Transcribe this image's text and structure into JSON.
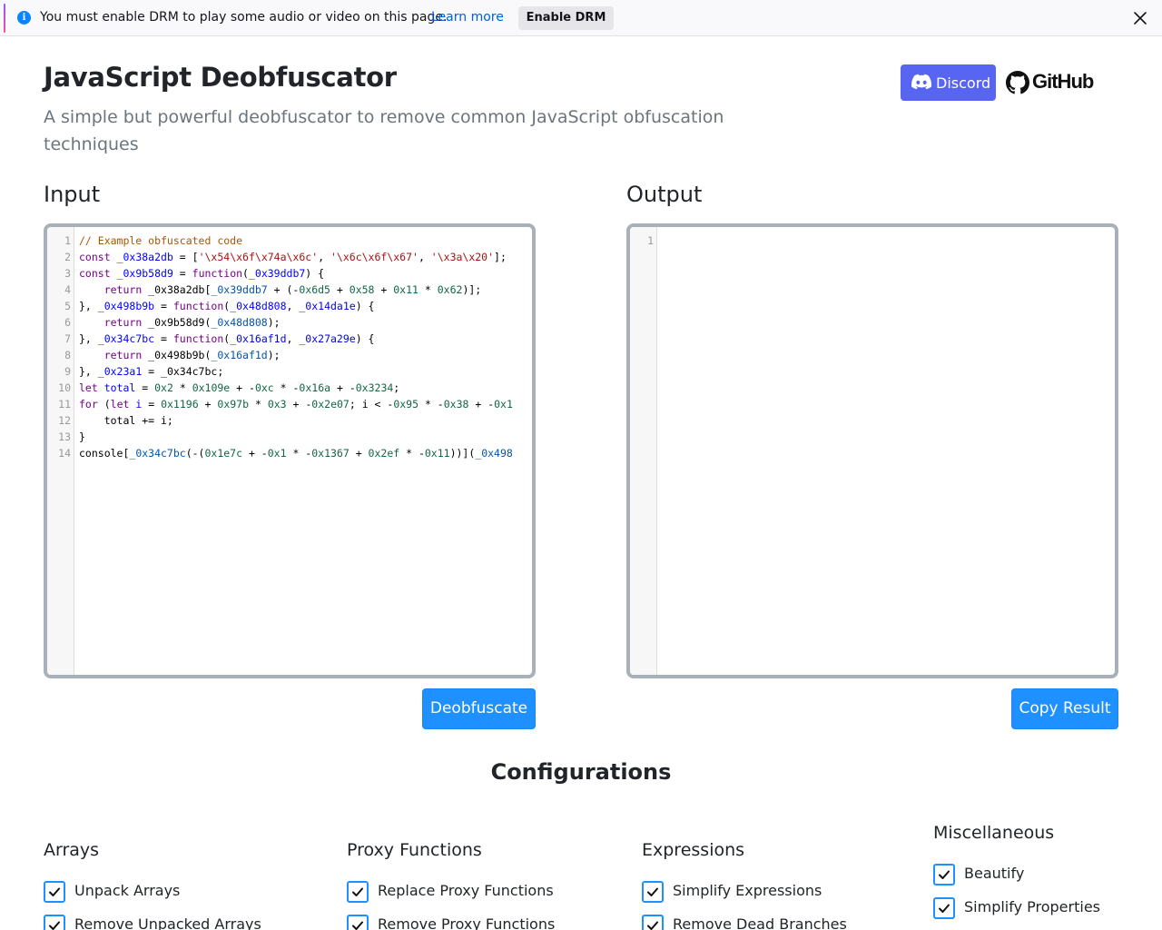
{
  "notification": {
    "message": "You must enable DRM to play some audio or video on this page.",
    "learn_more": "Learn more",
    "enable_button": "Enable DRM"
  },
  "header": {
    "title": "JavaScript Deobfuscator",
    "subtitle": "A simple but powerful deobfuscator to remove common JavaScript obfuscation techniques",
    "discord_label": "Discord",
    "github_label": "GitHub"
  },
  "input": {
    "title": "Input",
    "line_numbers": [
      "1",
      "2",
      "3",
      "4",
      "5",
      "6",
      "7",
      "8",
      "9",
      "10",
      "11",
      "12",
      "13",
      "14"
    ],
    "code_lines": [
      "// Example obfuscated code",
      "const _0x38a2db = ['\\x54\\x6f\\x74a\\x6c', '\\x6c\\x6f\\x67', '\\x3a\\x20'];",
      "const _0x9b58d9 = function(_0x39ddb7) {",
      "    return _0x38a2db[_0x39ddb7 + (-0x6d5 + 0x58 + 0x11 * 0x62)];",
      "}, _0x498b9b = function(_0x48d808, _0x14da1e) {",
      "    return _0x9b58d9(_0x48d808);",
      "}, _0x34c7bc = function(_0x16af1d, _0x27a29e) {",
      "    return _0x498b9b(_0x16af1d);",
      "}, _0x23a1 = _0x34c7bc;",
      "let total = 0x2 * 0x109e + -0xc * -0x16a + -0x3234;",
      "for (let i = 0x1196 + 0x97b * 0x3 + -0x2e07; i < -0x95 * -0x38 + -0x1",
      "    total += i;",
      "}",
      "console[_0x34c7bc(-(0x1e7c + -0x1 * -0x1367 + 0x2ef * -0x11))](_0x498"
    ],
    "button": "Deobfuscate"
  },
  "output": {
    "title": "Output",
    "line_numbers": [
      "1"
    ],
    "button": "Copy Result"
  },
  "configurations": {
    "title": "Configurations",
    "groups": [
      {
        "title": "Arrays",
        "options": [
          {
            "label": "Unpack Arrays",
            "checked": true
          },
          {
            "label": "Remove Unpacked Arrays",
            "checked": true
          }
        ]
      },
      {
        "title": "Proxy Functions",
        "options": [
          {
            "label": "Replace Proxy Functions",
            "checked": true
          },
          {
            "label": "Remove Proxy Functions",
            "checked": true
          }
        ]
      },
      {
        "title": "Expressions",
        "options": [
          {
            "label": "Simplify Expressions",
            "checked": true
          },
          {
            "label": "Remove Dead Branches",
            "checked": true
          }
        ]
      },
      {
        "title": "Miscellaneous",
        "options": [
          {
            "label": "Beautify",
            "checked": true
          },
          {
            "label": "Simplify Properties",
            "checked": true
          }
        ]
      }
    ]
  },
  "colors": {
    "accent": "#1e90ff",
    "discord": "#5865f2",
    "editor_border": "#a8b0ba"
  }
}
